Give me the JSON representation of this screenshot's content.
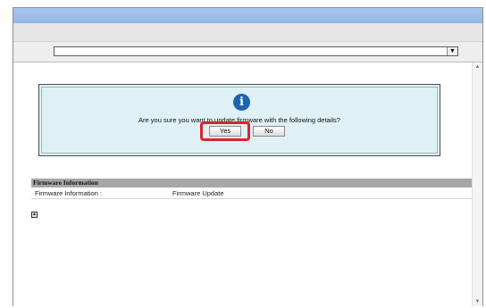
{
  "dialog": {
    "message": "Are you sure you want to update firmware with the following details?",
    "yes_label": "Yes",
    "no_label": "No"
  },
  "firmware": {
    "section_title": "Firmware Information",
    "row_label": "Firmware Information :",
    "row_value": "Firmware Update"
  },
  "icons": {
    "info": "info-icon",
    "dropdown": "chevron-down-icon",
    "page_top": "page-top-icon",
    "scroll_up": "scroll-up-icon",
    "scroll_down": "scroll-down-icon"
  },
  "colors": {
    "titlebar": "#a9c6ee",
    "dialog_bg": "#dff1f4",
    "highlight": "#d8262b",
    "info_icon": "#1b64b3",
    "section_header": "#a7a7a7"
  }
}
